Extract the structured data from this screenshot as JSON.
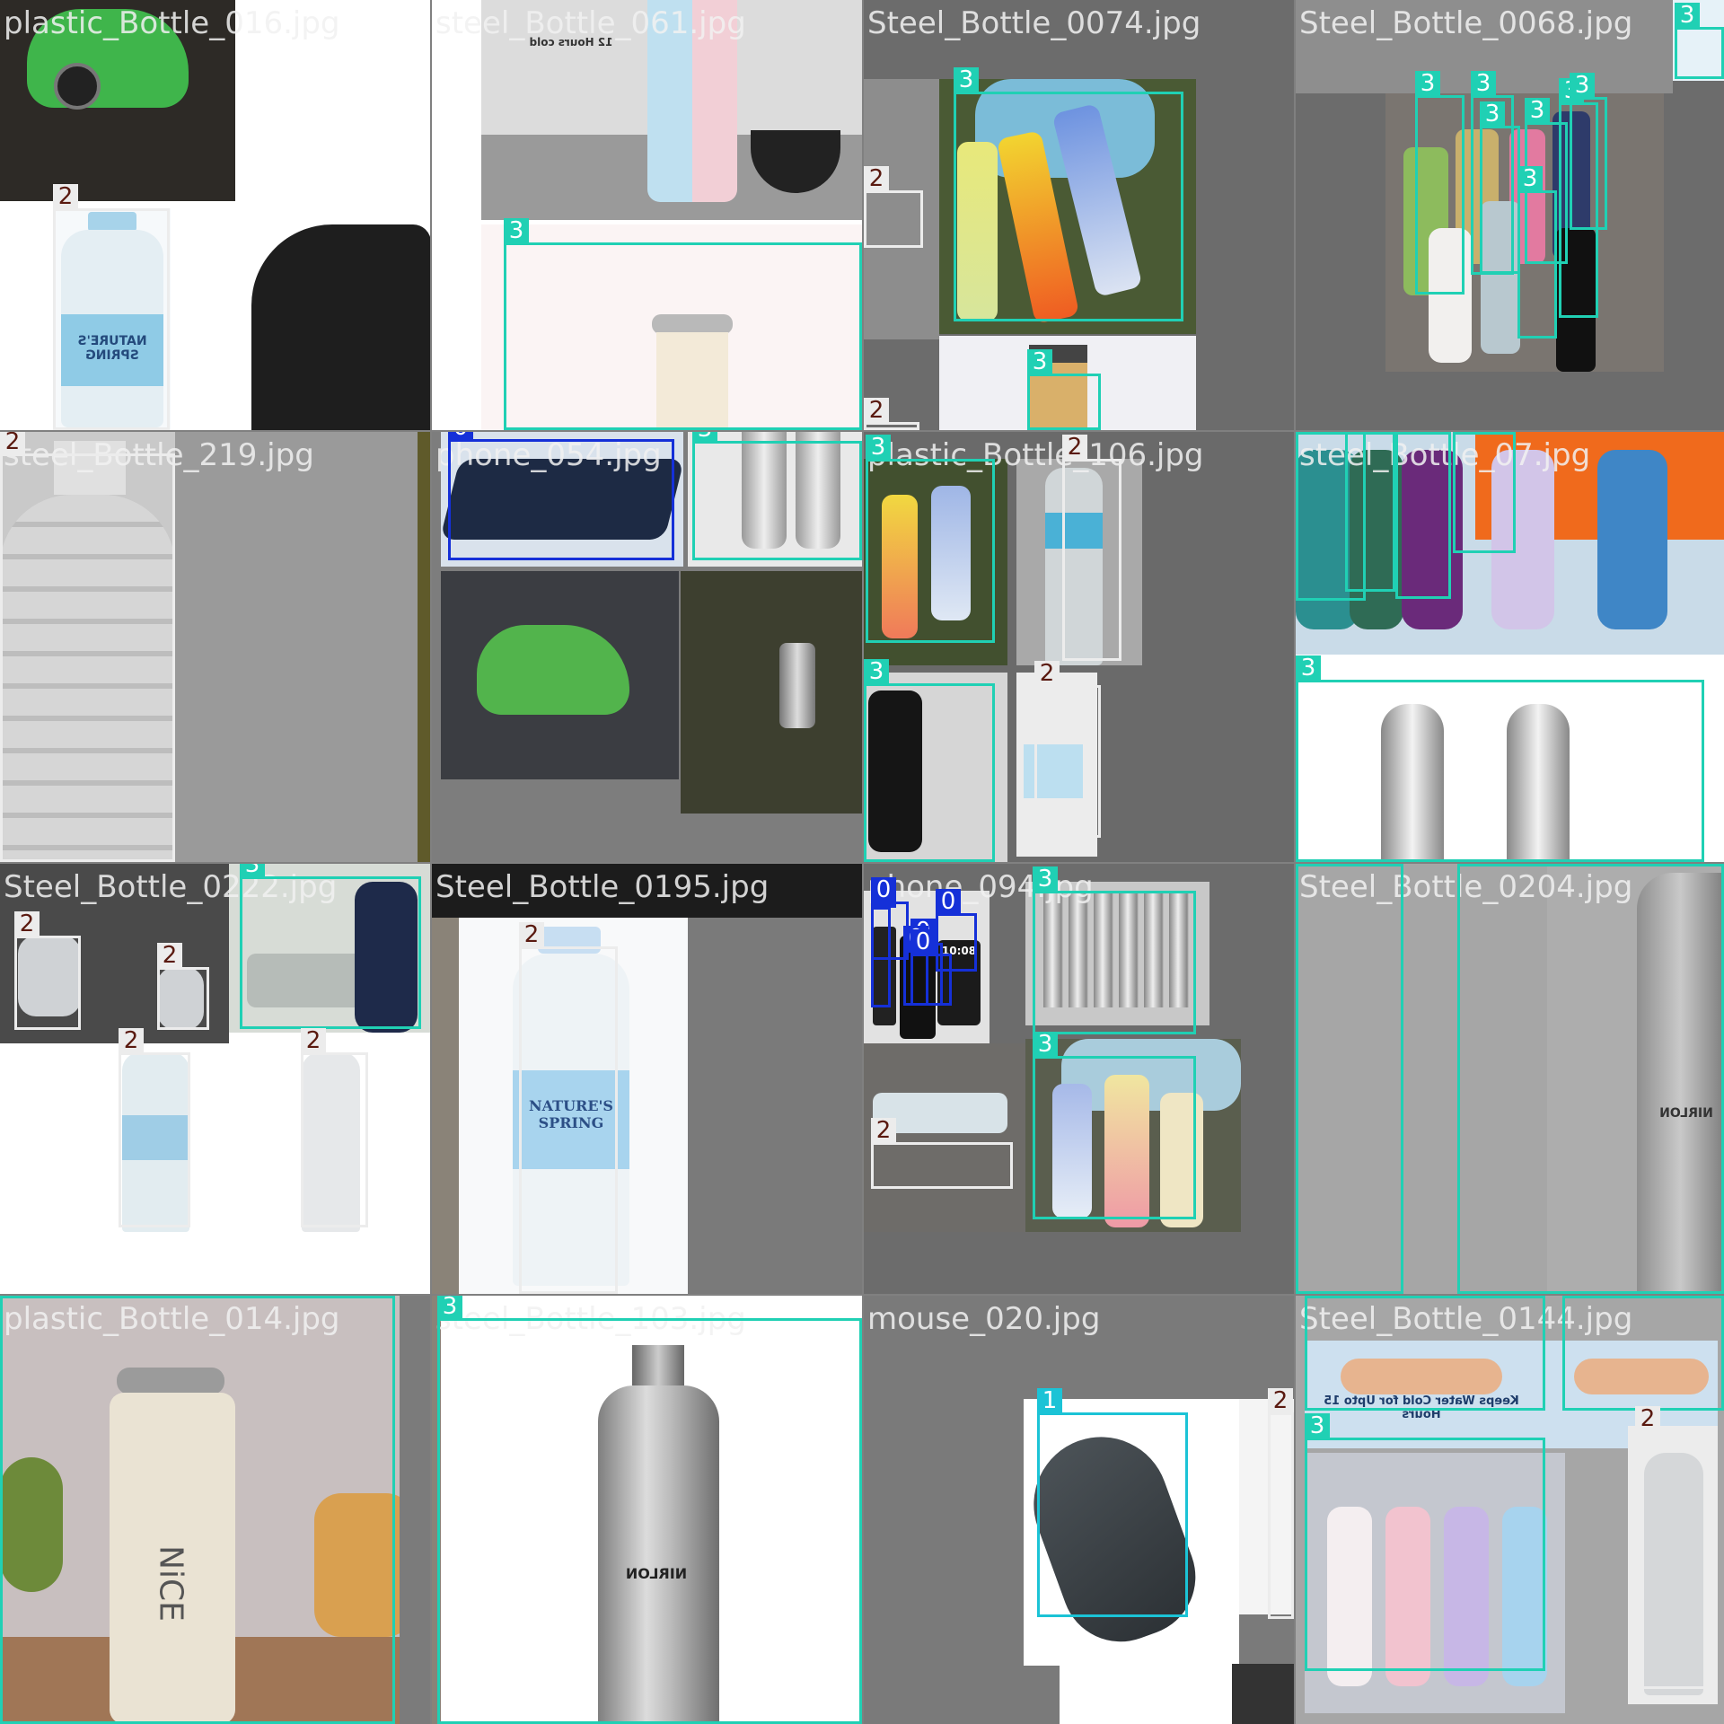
{
  "classes": {
    "0": {
      "name": "0",
      "color": "#1530d8",
      "text": "#ffffff"
    },
    "1": {
      "name": "1",
      "color": "#1bc3d6",
      "text": "#ffffff"
    },
    "2": {
      "name": "2",
      "color": "#ececec",
      "text": "#5a1a10"
    },
    "3": {
      "name": "3",
      "color": "#20d0b4",
      "text": "#ffffff"
    }
  },
  "tiles": [
    {
      "filename": "plastic_Bottle_016.jpg"
    },
    {
      "filename": "steel_Bottle_061.jpg"
    },
    {
      "filename": "Steel_Bottle_0074.jpg"
    },
    {
      "filename": "Steel_Bottle_0068.jpg"
    },
    {
      "filename": "steel_Bottle_219.jpg"
    },
    {
      "filename": "phone_054.jpg"
    },
    {
      "filename": "plastic_Bottle_106.jpg"
    },
    {
      "filename": "steel_Bottle_07.jpg"
    },
    {
      "filename": "Steel_Bottle_0222.jpg"
    },
    {
      "filename": "Steel_Bottle_0195.jpg"
    },
    {
      "filename": "phone_094.jpg"
    },
    {
      "filename": "Steel_Bottle_0204.jpg"
    },
    {
      "filename": "plastic_Bottle_014.jpg"
    },
    {
      "filename": "steel_Bottle_103.jpg"
    },
    {
      "filename": "mouse_020.jpg"
    },
    {
      "filename": "Steel_Bottle_0144.jpg"
    }
  ],
  "photo_text": {
    "natures_spring": "NATURE'S SPRING",
    "nice": "NiCE",
    "keeps_cold": "Keeps Water Cold for Upto 15 Hours",
    "twelve_hours": "12 Hours cold",
    "nirlon": "NIRLON",
    "phone_time": "10:08"
  }
}
